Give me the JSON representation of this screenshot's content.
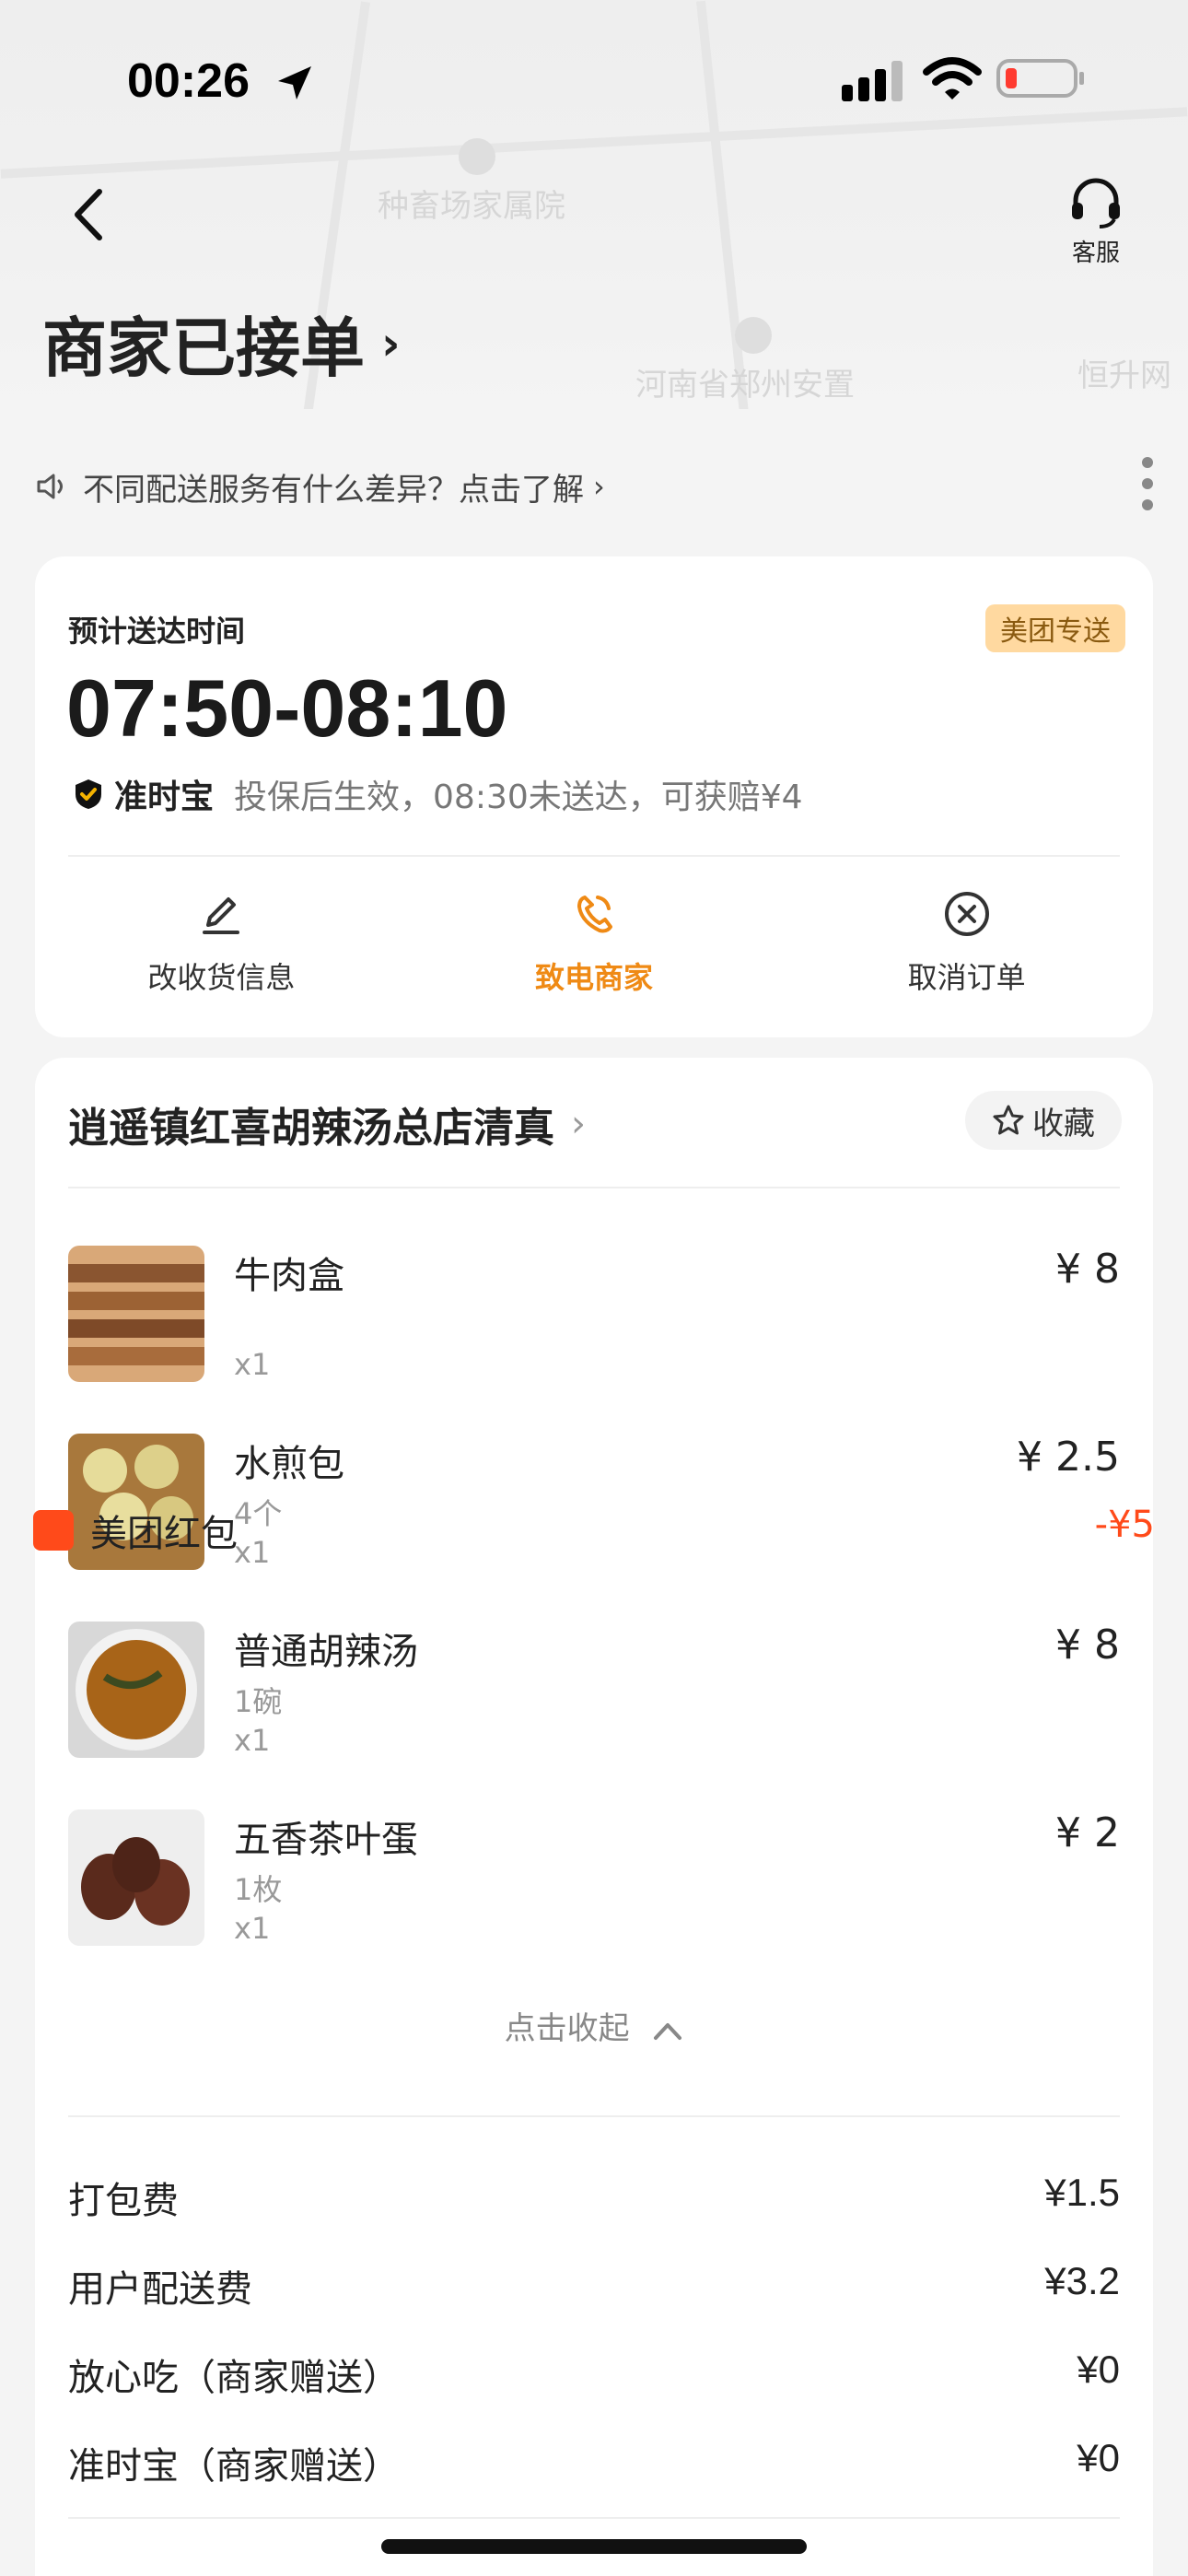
{
  "status_bar": {
    "time": "00:26"
  },
  "map": {
    "labels": [
      "种畜场家属院",
      "河南省郑州安置",
      "恒升网"
    ]
  },
  "header": {
    "service_label": "客服",
    "order_status": "商家已接单"
  },
  "notice": {
    "text": "不同配送服务有什么差异？点击了解"
  },
  "delivery": {
    "eta_label": "预计送达时间",
    "badge": "美团专送",
    "eta_time": "07:50-08:10",
    "insure_name": "准时宝",
    "insure_desc": "投保后生效，08:30未送达，可获赔¥4"
  },
  "actions": [
    {
      "label": "改收货信息",
      "icon": "edit-icon"
    },
    {
      "label": "致电商家",
      "icon": "phone-icon"
    },
    {
      "label": "取消订单",
      "icon": "cancel-icon"
    }
  ],
  "shop": {
    "name": "逍遥镇红喜胡辣汤总店清真",
    "fav_label": "收藏"
  },
  "items": [
    {
      "name": "牛肉盒",
      "spec": "",
      "qty": "x1",
      "price": "¥ 8"
    },
    {
      "name": "水煎包",
      "spec": "4个",
      "qty": "x1",
      "price": "¥ 2.5"
    },
    {
      "name": "普通胡辣汤",
      "spec": "1碗",
      "qty": "x1",
      "price": "¥ 8"
    },
    {
      "name": "五香茶叶蛋",
      "spec": "1枚",
      "qty": "x1",
      "price": "¥ 2"
    }
  ],
  "collapse_label": "点击收起",
  "fees": [
    {
      "label": "打包费",
      "value": "¥1.5"
    },
    {
      "label": "用户配送费",
      "value": "¥3.2"
    },
    {
      "label": "放心吃（商家赠送）",
      "value": "¥0"
    },
    {
      "label": "准时宝（商家赠送）",
      "value": "¥0"
    }
  ],
  "partial": {
    "label": "美团红包",
    "value": "-¥5"
  },
  "colors": {
    "accent": "#ef8a15",
    "badge_bg": "#ffd9a0",
    "red": "#ff4a1a"
  }
}
